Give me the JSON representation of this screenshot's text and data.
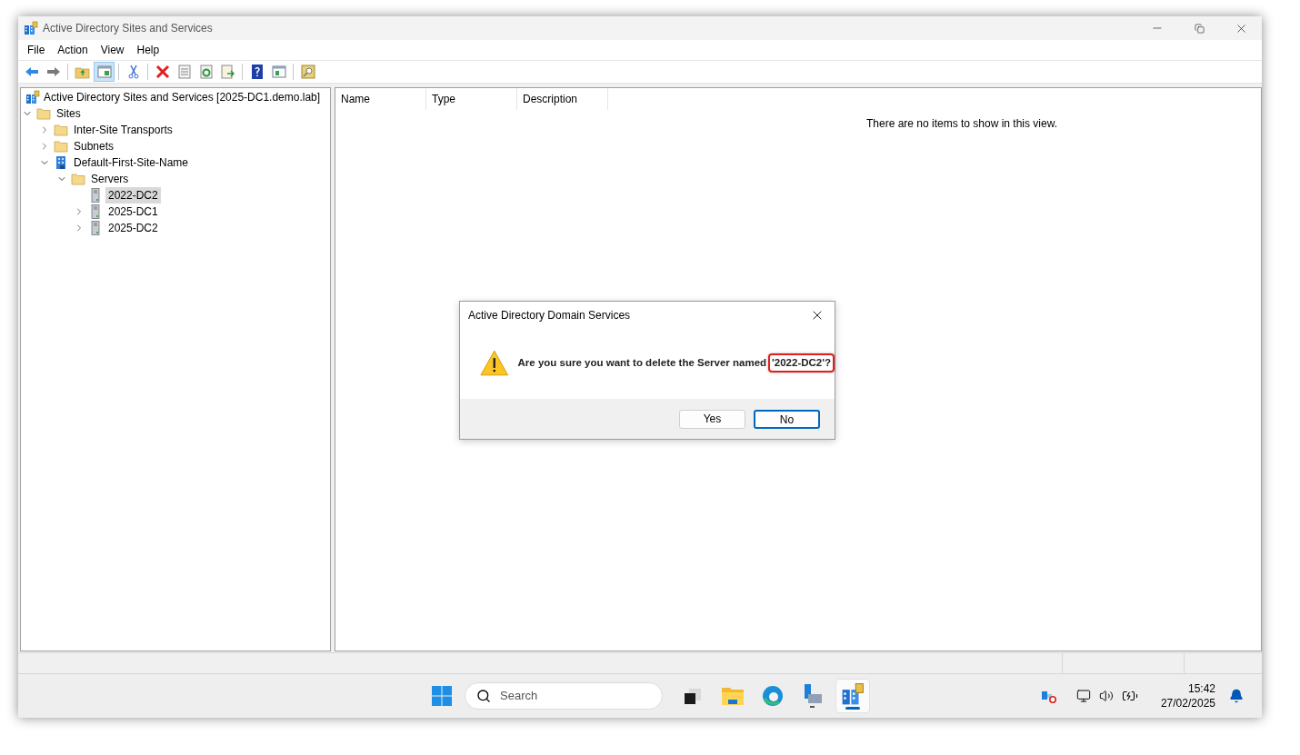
{
  "window": {
    "title": "Active Directory Sites and Services"
  },
  "menu": [
    {
      "label": "File"
    },
    {
      "label": "Action"
    },
    {
      "label": "View"
    },
    {
      "label": "Help"
    }
  ],
  "toolbar": [
    {
      "kind": "back",
      "pressed": false
    },
    {
      "kind": "forward",
      "pressed": false
    },
    {
      "kind": "separator"
    },
    {
      "kind": "up",
      "pressed": false
    },
    {
      "kind": "tree",
      "pressed": true
    },
    {
      "kind": "separator"
    },
    {
      "kind": "cut",
      "pressed": false
    },
    {
      "kind": "separator"
    },
    {
      "kind": "delete",
      "pressed": false
    },
    {
      "kind": "properties",
      "pressed": false
    },
    {
      "kind": "refresh",
      "pressed": false
    },
    {
      "kind": "export",
      "pressed": false
    },
    {
      "kind": "separator"
    },
    {
      "kind": "help",
      "pressed": false
    },
    {
      "kind": "pane",
      "pressed": false
    },
    {
      "kind": "separator"
    },
    {
      "kind": "find",
      "pressed": false
    }
  ],
  "tree": [
    {
      "label": "Active Directory Sites and Services [2025-DC1.demo.lab]",
      "kind": "root",
      "selected": false,
      "children": [
        {
          "label": "Sites",
          "kind": "folder",
          "expanded": true,
          "selected": false,
          "children": [
            {
              "label": "Inter-Site Transports",
              "kind": "folder",
              "expanded": false,
              "selected": false
            },
            {
              "label": "Subnets",
              "kind": "folder",
              "expanded": false,
              "selected": false
            },
            {
              "label": "Default-First-Site-Name",
              "kind": "site",
              "expanded": true,
              "selected": false,
              "children": [
                {
                  "label": "Servers",
                  "kind": "folder",
                  "expanded": true,
                  "selected": false,
                  "children": [
                    {
                      "label": "2022-DC2",
                      "kind": "server",
                      "selected": true
                    },
                    {
                      "label": "2025-DC1",
                      "kind": "server",
                      "expanded": false,
                      "selected": false
                    },
                    {
                      "label": "2025-DC2",
                      "kind": "server",
                      "expanded": false,
                      "selected": false
                    }
                  ]
                }
              ]
            }
          ]
        }
      ]
    }
  ],
  "list": {
    "columns": [
      {
        "label": "Name"
      },
      {
        "label": "Type"
      },
      {
        "label": "Description"
      }
    ],
    "empty_message": "There are no items to show in this view."
  },
  "dialog": {
    "title": "Active Directory Domain Services",
    "message": "Are you sure you want to delete the Server named",
    "highlighted": "'2022-DC2'?",
    "buttons": [
      {
        "label": "Yes",
        "default": false
      },
      {
        "label": "No",
        "default": true
      }
    ]
  },
  "taskbar": {
    "search": {
      "placeholder": "Search"
    },
    "apps": [
      {
        "kind": "taskview",
        "active": false
      },
      {
        "kind": "explorer",
        "active": false
      },
      {
        "kind": "edge",
        "active": false
      },
      {
        "kind": "servermanager",
        "active": false
      },
      {
        "kind": "adsites",
        "active": true
      }
    ],
    "time": "15:42",
    "date": "27/02/2025"
  }
}
